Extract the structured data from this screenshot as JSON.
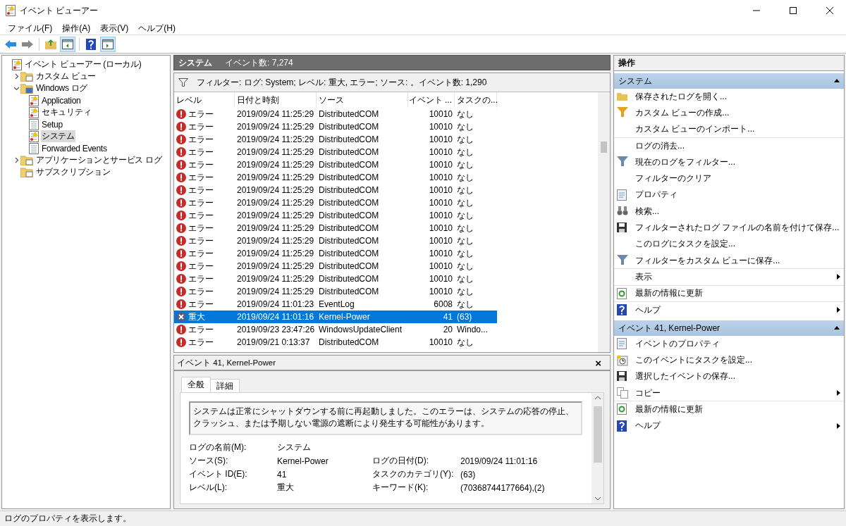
{
  "window": {
    "title": "イベント ビューアー"
  },
  "menu": [
    "ファイル(F)",
    "操作(A)",
    "表示(V)",
    "ヘルプ(H)"
  ],
  "toolbar": [
    {
      "kind": "back",
      "pressed": false
    },
    {
      "kind": "forward",
      "pressed": false
    },
    {
      "kind": "up",
      "pressed": false
    },
    {
      "kind": "pane-left",
      "pressed": true
    },
    {
      "kind": "help",
      "pressed": false
    },
    {
      "kind": "pane-right",
      "pressed": true
    }
  ],
  "tree": [
    {
      "label": "イベント ビューアー (ローカル)",
      "kind": "viewer",
      "selected": false,
      "children": [
        {
          "label": "カスタム ビュー",
          "kind": "folder",
          "expanded": false,
          "selected": false
        },
        {
          "label": "Windows ログ",
          "kind": "folder-pc",
          "expanded": true,
          "selected": false,
          "children": [
            {
              "label": "Application",
              "kind": "log-alert",
              "selected": false
            },
            {
              "label": "セキュリティ",
              "kind": "log-alert",
              "selected": false
            },
            {
              "label": "Setup",
              "kind": "log",
              "selected": false
            },
            {
              "label": "システム",
              "kind": "log-alert",
              "selected": true
            },
            {
              "label": "Forwarded Events",
              "kind": "log",
              "selected": false
            }
          ]
        },
        {
          "label": "アプリケーションとサービス ログ",
          "kind": "folder",
          "expanded": false,
          "selected": false
        },
        {
          "label": "サブスクリプション",
          "kind": "folder",
          "selected": false
        }
      ]
    }
  ],
  "log_header": {
    "title": "システム",
    "count": "イベント数: 7,274"
  },
  "filter": "フィルター: ログ: System; レベル: 重大, エラー; ソース: 。イベント数: 1,290",
  "table": {
    "columns": [
      "レベル",
      "日付と時刻",
      "ソース",
      "イベント ...",
      "タスクの..."
    ],
    "rows": [
      {
        "kind": "error",
        "level": "エラー",
        "date": "2019/09/24 11:25:29",
        "source": "DistributedCOM",
        "id": "10010",
        "task": "なし",
        "selected": false
      },
      {
        "kind": "error",
        "level": "エラー",
        "date": "2019/09/24 11:25:29",
        "source": "DistributedCOM",
        "id": "10010",
        "task": "なし",
        "selected": false
      },
      {
        "kind": "error",
        "level": "エラー",
        "date": "2019/09/24 11:25:29",
        "source": "DistributedCOM",
        "id": "10010",
        "task": "なし",
        "selected": false
      },
      {
        "kind": "error",
        "level": "エラー",
        "date": "2019/09/24 11:25:29",
        "source": "DistributedCOM",
        "id": "10010",
        "task": "なし",
        "selected": false
      },
      {
        "kind": "error",
        "level": "エラー",
        "date": "2019/09/24 11:25:29",
        "source": "DistributedCOM",
        "id": "10010",
        "task": "なし",
        "selected": false
      },
      {
        "kind": "error",
        "level": "エラー",
        "date": "2019/09/24 11:25:29",
        "source": "DistributedCOM",
        "id": "10010",
        "task": "なし",
        "selected": false
      },
      {
        "kind": "error",
        "level": "エラー",
        "date": "2019/09/24 11:25:29",
        "source": "DistributedCOM",
        "id": "10010",
        "task": "なし",
        "selected": false
      },
      {
        "kind": "error",
        "level": "エラー",
        "date": "2019/09/24 11:25:29",
        "source": "DistributedCOM",
        "id": "10010",
        "task": "なし",
        "selected": false
      },
      {
        "kind": "error",
        "level": "エラー",
        "date": "2019/09/24 11:25:29",
        "source": "DistributedCOM",
        "id": "10010",
        "task": "なし",
        "selected": false
      },
      {
        "kind": "error",
        "level": "エラー",
        "date": "2019/09/24 11:25:29",
        "source": "DistributedCOM",
        "id": "10010",
        "task": "なし",
        "selected": false
      },
      {
        "kind": "error",
        "level": "エラー",
        "date": "2019/09/24 11:25:29",
        "source": "DistributedCOM",
        "id": "10010",
        "task": "なし",
        "selected": false
      },
      {
        "kind": "error",
        "level": "エラー",
        "date": "2019/09/24 11:25:29",
        "source": "DistributedCOM",
        "id": "10010",
        "task": "なし",
        "selected": false
      },
      {
        "kind": "error",
        "level": "エラー",
        "date": "2019/09/24 11:25:29",
        "source": "DistributedCOM",
        "id": "10010",
        "task": "なし",
        "selected": false
      },
      {
        "kind": "error",
        "level": "エラー",
        "date": "2019/09/24 11:25:29",
        "source": "DistributedCOM",
        "id": "10010",
        "task": "なし",
        "selected": false
      },
      {
        "kind": "error",
        "level": "エラー",
        "date": "2019/09/24 11:25:29",
        "source": "DistributedCOM",
        "id": "10010",
        "task": "なし",
        "selected": false
      },
      {
        "kind": "error",
        "level": "エラー",
        "date": "2019/09/24 11:01:23",
        "source": "EventLog",
        "id": "6008",
        "task": "なし",
        "selected": false
      },
      {
        "kind": "critical",
        "level": "重大",
        "date": "2019/09/24 11:01:16",
        "source": "Kernel-Power",
        "id": "41",
        "task": "(63)",
        "selected": true
      },
      {
        "kind": "error",
        "level": "エラー",
        "date": "2019/09/23 23:47:26",
        "source": "WindowsUpdateClient",
        "id": "20",
        "task": "Windo...",
        "selected": false
      },
      {
        "kind": "error",
        "level": "エラー",
        "date": "2019/09/21 0:13:37",
        "source": "DistributedCOM",
        "id": "10010",
        "task": "なし",
        "selected": false
      }
    ]
  },
  "details": {
    "title": "イベント 41, Kernel-Power",
    "close": "×",
    "tabs": [
      {
        "label": "全般",
        "selected": true
      },
      {
        "label": "詳細",
        "selected": false
      }
    ],
    "message": "システムは正常にシャットダウンする前に再起動しました。このエラーは、システムの応答の停止、クラッシュ、または予期しない電源の遮断により発生する可能性があります。",
    "fields_left": [
      {
        "label": "ログの名前(M):",
        "value": "システム"
      },
      {
        "label": "ソース(S):",
        "value": "Kernel-Power"
      },
      {
        "label": "イベント ID(E):",
        "value": "41"
      },
      {
        "label": "レベル(L):",
        "value": "重大"
      }
    ],
    "fields_right": [
      {
        "label": "ログの日付(D):",
        "value": "2019/09/24 11:01:16"
      },
      {
        "label": "タスクのカテゴリ(Y):",
        "value": "(63)"
      },
      {
        "label": "キーワード(K):",
        "value": "(70368744177664),(2)"
      }
    ]
  },
  "actions": {
    "title": "操作",
    "sections": [
      {
        "title": "システム",
        "expanded": true,
        "items": [
          {
            "label": "保存されたログを開く...",
            "kind": "open",
            "submenu": false,
            "divider": false
          },
          {
            "label": "カスタム ビューの作成...",
            "kind": "filter-new",
            "submenu": false,
            "divider": false
          },
          {
            "label": "カスタム ビューのインポート...",
            "kind": "plain",
            "submenu": false,
            "divider": true
          },
          {
            "label": "ログの消去...",
            "kind": "plain",
            "submenu": false,
            "divider": false
          },
          {
            "label": "現在のログをフィルター...",
            "kind": "filter",
            "submenu": false,
            "divider": false
          },
          {
            "label": "フィルターのクリア",
            "kind": "plain",
            "submenu": false,
            "divider": false
          },
          {
            "label": "プロパティ",
            "kind": "props",
            "submenu": false,
            "divider": false
          },
          {
            "label": "検索...",
            "kind": "find",
            "submenu": false,
            "divider": false
          },
          {
            "label": "フィルターされたログ ファイルの名前を付けて保存...",
            "kind": "save",
            "submenu": false,
            "divider": false
          },
          {
            "label": "このログにタスクを設定...",
            "kind": "plain",
            "submenu": false,
            "divider": false
          },
          {
            "label": "フィルターをカスタム ビューに保存...",
            "kind": "filter",
            "submenu": false,
            "divider": true
          },
          {
            "label": "表示",
            "kind": "plain",
            "submenu": true,
            "divider": true
          },
          {
            "label": "最新の情報に更新",
            "kind": "refresh",
            "submenu": false,
            "divider": true
          },
          {
            "label": "ヘルプ",
            "kind": "help",
            "submenu": true,
            "divider": false
          }
        ]
      },
      {
        "title": "イベント 41, Kernel-Power",
        "expanded": true,
        "items": [
          {
            "label": "イベントのプロパティ",
            "kind": "props",
            "submenu": false,
            "divider": false
          },
          {
            "label": "このイベントにタスクを設定...",
            "kind": "task",
            "submenu": false,
            "divider": false
          },
          {
            "label": "選択したイベントの保存...",
            "kind": "save",
            "submenu": false,
            "divider": false
          },
          {
            "label": "コピー",
            "kind": "copy",
            "submenu": true,
            "divider": true
          },
          {
            "label": "最新の情報に更新",
            "kind": "refresh",
            "submenu": false,
            "divider": false
          },
          {
            "label": "ヘルプ",
            "kind": "help",
            "submenu": true,
            "divider": false
          }
        ]
      }
    ]
  },
  "status_bar": "ログのプロパティを表示します。"
}
